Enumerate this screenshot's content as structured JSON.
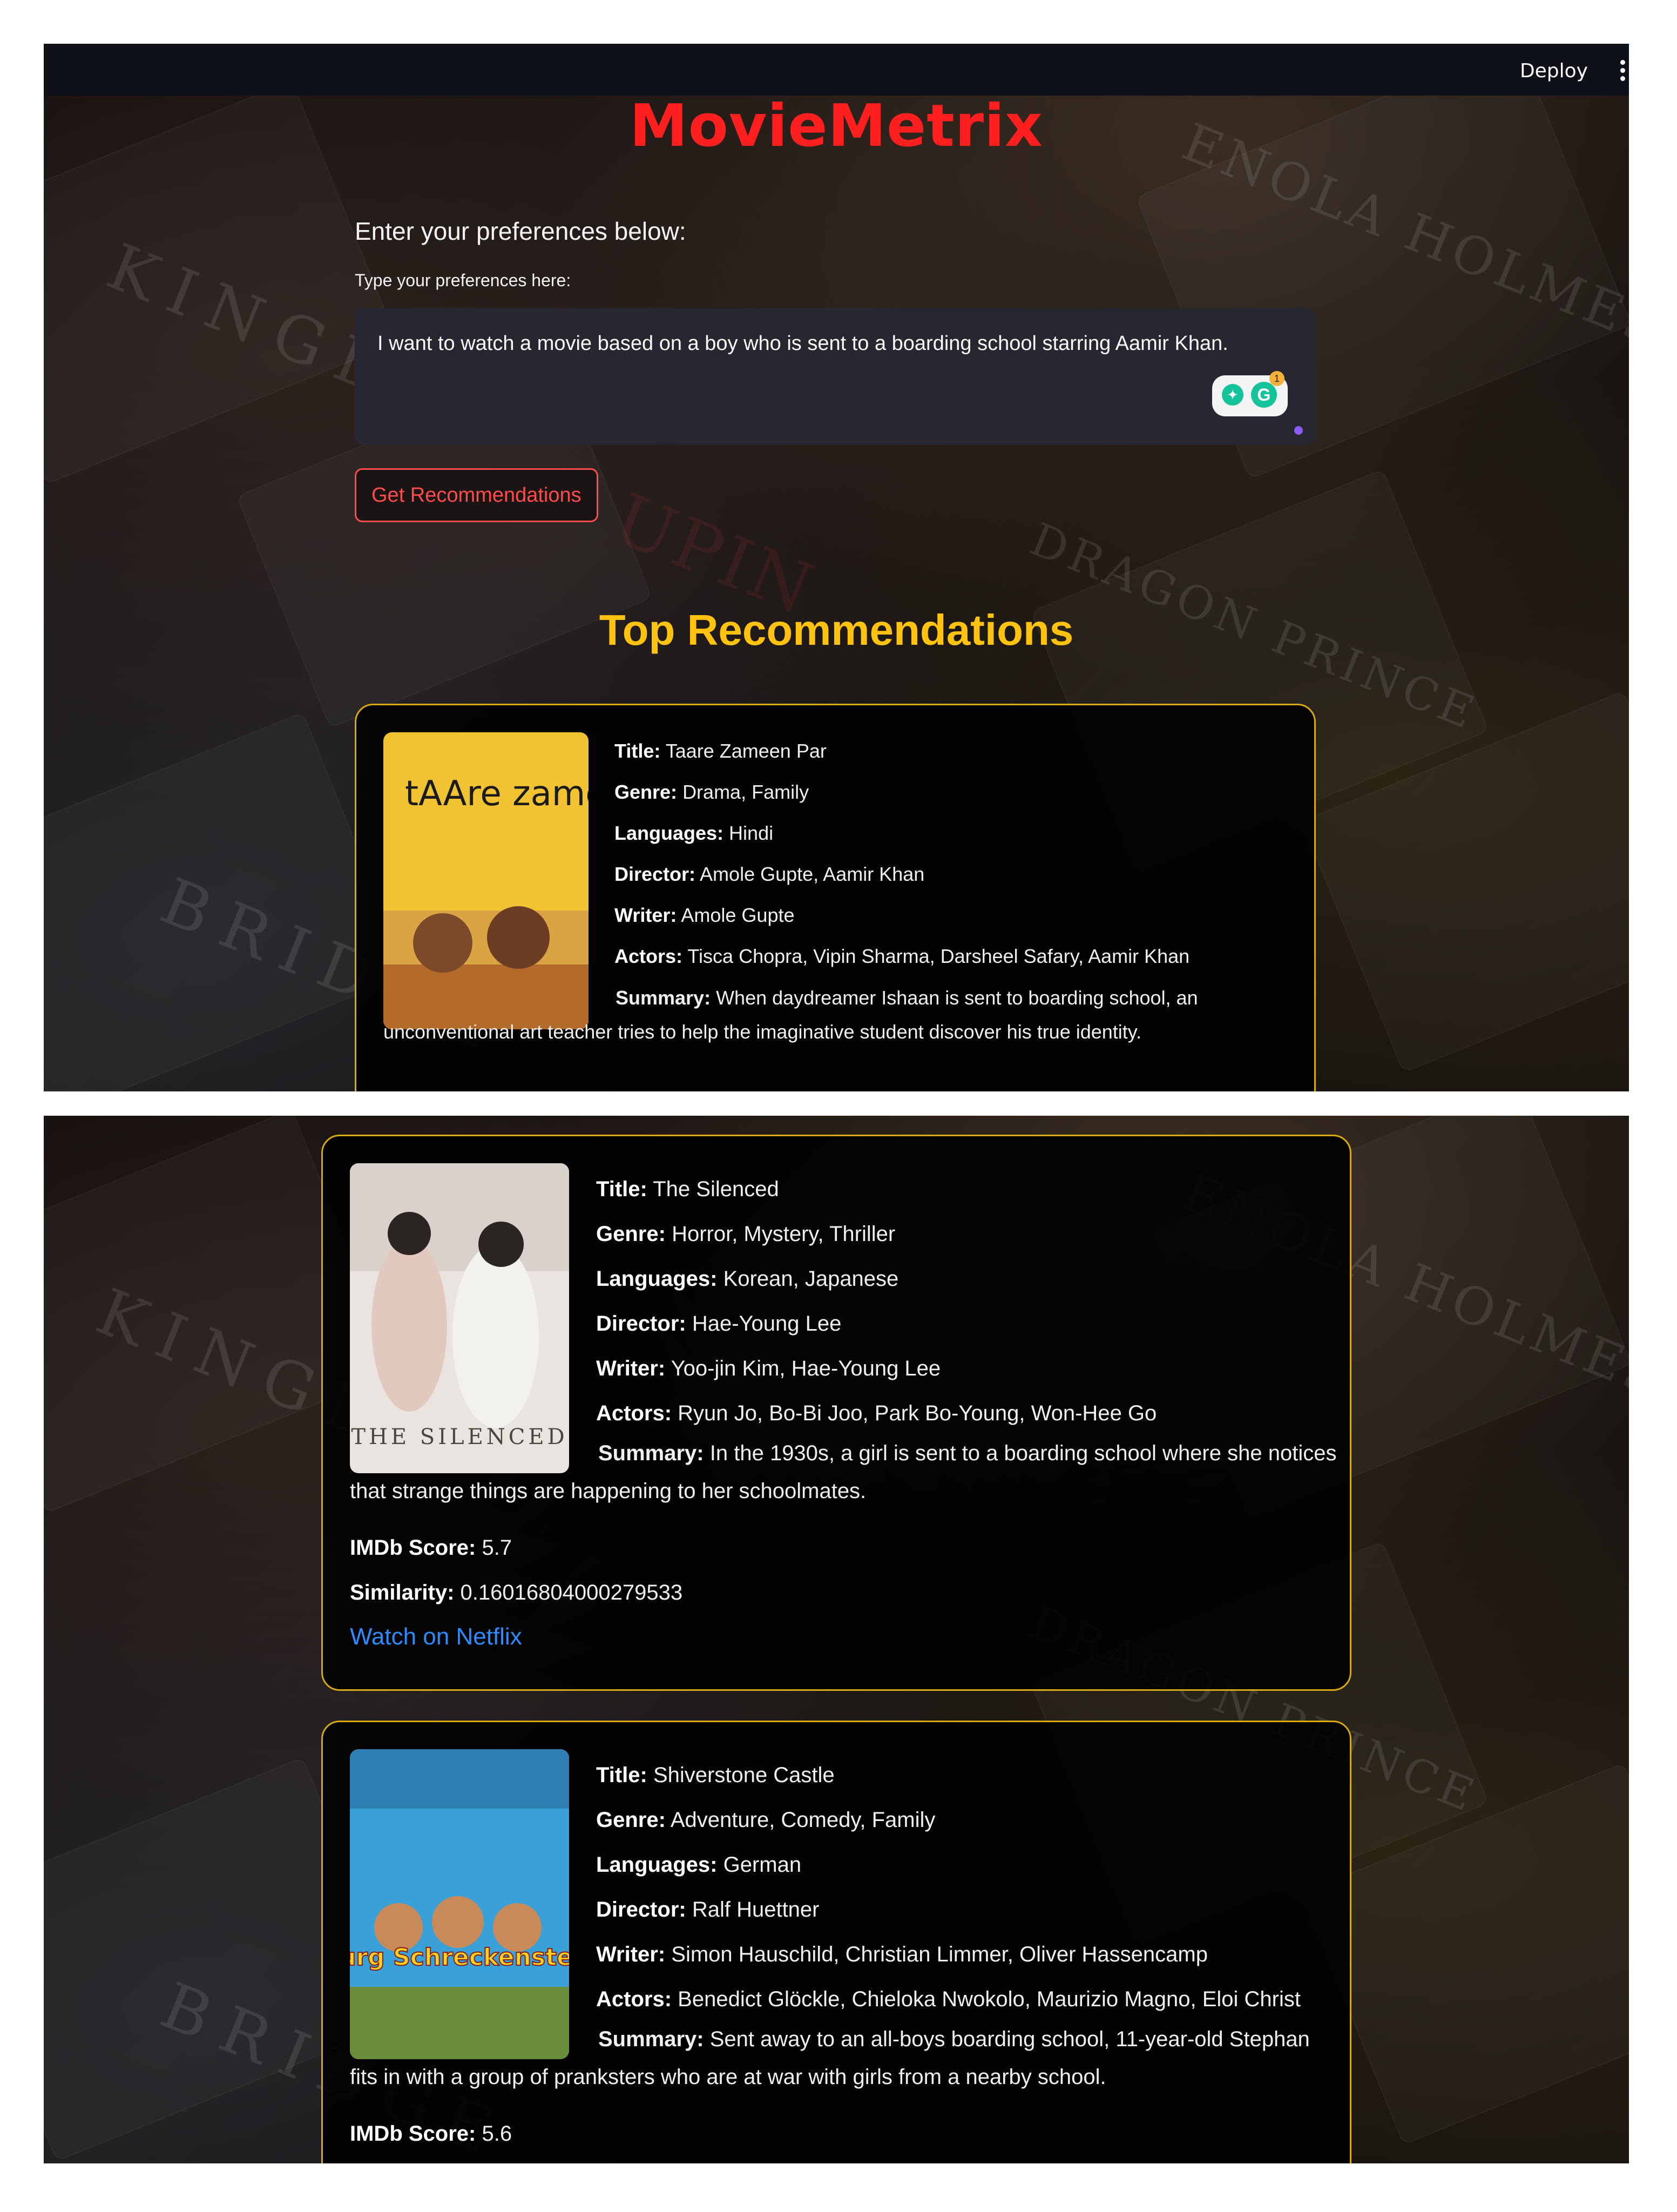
{
  "app": {
    "title": "MovieMetrix",
    "deploy_label": "Deploy"
  },
  "form": {
    "prompt": "Enter your preferences below:",
    "field_label": "Type your preferences here:",
    "value": "I want to watch a movie based on a boy who is sent to a boarding school starring Aamir Khan.",
    "button_label": "Get Recommendations"
  },
  "results": {
    "heading": "Top Recommendations",
    "labels": {
      "title": "Title:",
      "genre": "Genre:",
      "languages": "Languages:",
      "director": "Director:",
      "writer": "Writer:",
      "actors": "Actors:",
      "summary": "Summary:",
      "imdb": "IMDb Score:",
      "similarity": "Similarity:"
    },
    "watch_link": "Watch on Netflix",
    "movies": [
      {
        "title": "Taare Zameen Par",
        "genre": "Drama, Family",
        "languages": "Hindi",
        "director": "Amole Gupte, Aamir Khan",
        "writer": "Amole Gupte",
        "actors": "Tisca Chopra, Vipin Sharma, Darsheel Safary, Aamir Khan",
        "summary": "When daydreamer Ishaan is sent to boarding school, an unconventional art teacher tries to help the imaginative student discover his true identity.",
        "poster_text": "tAAre zameeN Par"
      },
      {
        "title": "The Silenced",
        "genre": "Horror, Mystery, Thriller",
        "languages": "Korean, Japanese",
        "director": "Hae-Young Lee",
        "writer": "Yoo-jin Kim, Hae-Young Lee",
        "actors": "Ryun Jo, Bo-Bi Joo, Park Bo-Young, Won-Hee Go",
        "summary": "In the 1930s, a girl is sent to a boarding school where she notices that strange things are happening to her schoolmates.",
        "imdb": "5.7",
        "similarity": "0.16016804000279533",
        "poster_text": "THE SILENCED"
      },
      {
        "title": "Shiverstone Castle",
        "genre": "Adventure, Comedy, Family",
        "languages": "German",
        "director": "Ralf Huettner",
        "writer": "Simon Hauschild, Christian Limmer, Oliver Hassencamp",
        "actors": "Benedict Glöckle, Chieloka Nwokolo, Maurizio Magno, Eloi Christ",
        "summary": "Sent away to an all-boys boarding school, 11-year-old Stephan fits in with a group of pranksters who are at war with girls from a nearby school.",
        "imdb": "5.6",
        "poster_text": "Burg Schreckenstein"
      }
    ]
  },
  "background": {
    "words": [
      "KINGDO",
      "BRIDGE",
      "ENOLA HOLMES",
      "DRAGON PRINCE",
      "UPIN"
    ]
  },
  "colors": {
    "title_red": "#ff1f1f",
    "heading_gold": "#ffc20e",
    "card_border": "#d9a912",
    "button_red": "#ff4b4b",
    "link_blue": "#2e8bff",
    "topbar": "#0e1117",
    "input_bg": "#262730"
  }
}
